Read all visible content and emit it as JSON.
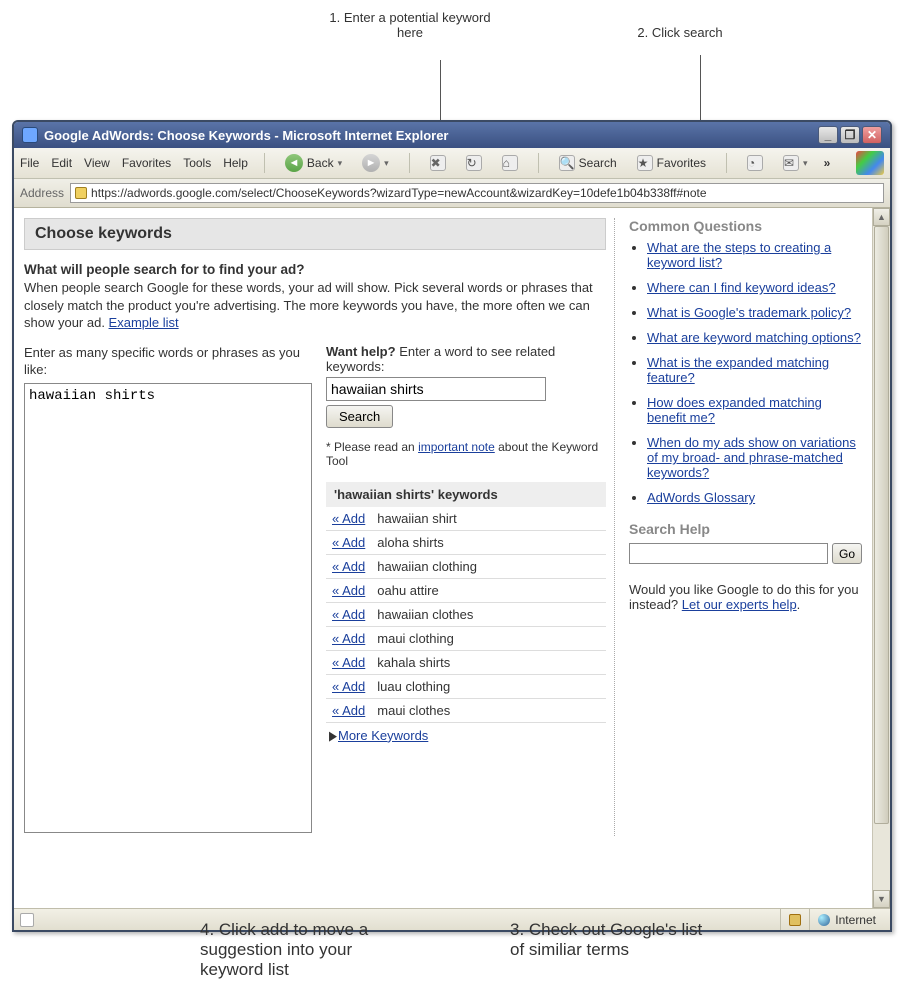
{
  "annotations": {
    "top1": "1. Enter a potential keyword here",
    "top2": "2. Click search",
    "bot1": "4. Click add to move a suggestion into your keyword list",
    "bot2": "3. Check out Google's list of similiar terms"
  },
  "window": {
    "title": "Google AdWords: Choose Keywords - Microsoft Internet Explorer",
    "min": "_",
    "max": "❐",
    "close": "✕"
  },
  "menu": {
    "file": "File",
    "edit": "Edit",
    "view": "View",
    "favorites": "Favorites",
    "tools": "Tools",
    "help": "Help",
    "back": "Back",
    "search": "Search",
    "favorites_btn": "Favorites",
    "chev": "»"
  },
  "address": {
    "label": "Address",
    "url": "https://adwords.google.com/select/ChooseKeywords?wizardType=newAccount&wizardKey=10defe1b04b338ff#note"
  },
  "page": {
    "heading": "Choose keywords",
    "q_heading": "What will people search for to find your ad?",
    "q_body": "When people search Google for these words, your ad will show. Pick several words or phrases that closely match the product you're advertising. The more keywords you have, the more often we can show your ad. ",
    "example_link": "Example list",
    "enter_label": "Enter as many specific words or phrases as you like:",
    "keyword_text": "hawaiian shirts",
    "want_help_bold": "Want help?",
    "want_help_rest": " Enter a word to see related keywords:",
    "help_input_value": "hawaiian shirts",
    "search_btn": "Search",
    "note_pre": "* Please read an ",
    "note_link": "important note",
    "note_post": " about the Keyword Tool",
    "results_title": "'hawaiian shirts' keywords",
    "add_label": "« Add",
    "suggestions": [
      "hawaiian shirt",
      "aloha shirts",
      "hawaiian clothing",
      "oahu attire",
      "hawaiian clothes",
      "maui clothing",
      "kahala shirts",
      "luau clothing",
      "maui clothes"
    ],
    "more_kw": "More Keywords"
  },
  "sidebar": {
    "cq_heading": "Common Questions",
    "questions": [
      "What are the steps to creating a keyword list?",
      "Where can I find keyword ideas?",
      "What is Google's trademark policy?",
      "What are keyword matching options?",
      "What is the expanded matching feature?",
      "How does expanded matching benefit me?",
      "When do my ads show on variations of my broad- and phrase-matched keywords?",
      "AdWords Glossary"
    ],
    "search_help_heading": "Search Help",
    "go_btn": "Go",
    "experts_pre": "Would you like Google to do this for you instead? ",
    "experts_link": "Let our experts help",
    "experts_post": "."
  },
  "status": {
    "zone": "Internet"
  }
}
